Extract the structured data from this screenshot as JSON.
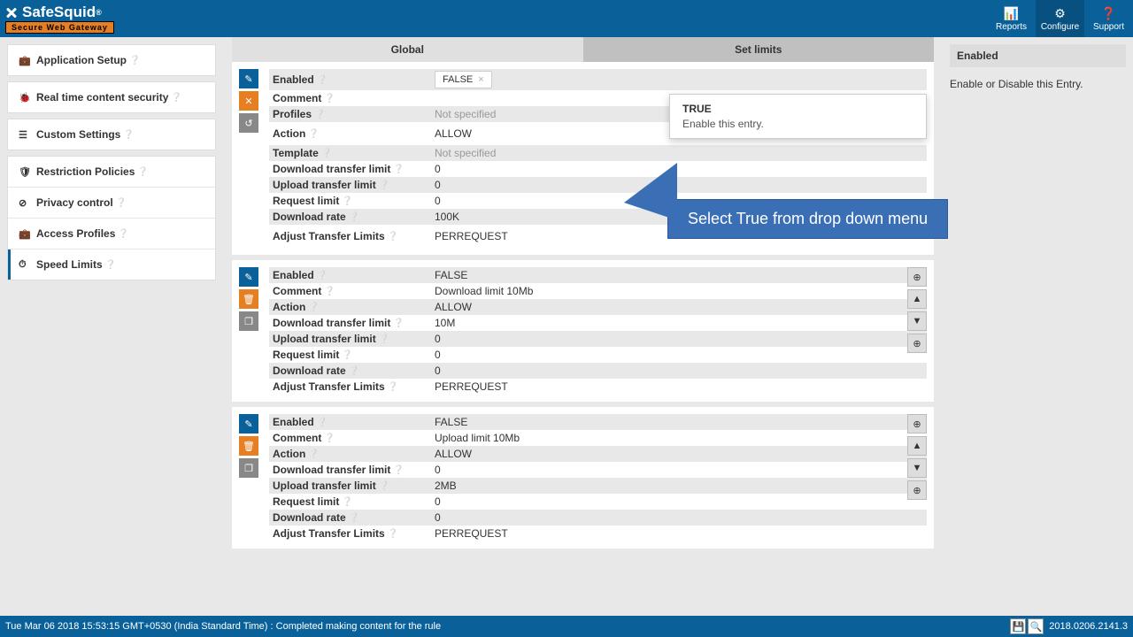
{
  "header": {
    "logo_text": "SafeSquid",
    "logo_reg": "®",
    "tagline": "Secure Web Gateway",
    "nav": [
      {
        "label": "Reports",
        "icon": "📊"
      },
      {
        "label": "Configure",
        "icon": "⚙"
      },
      {
        "label": "Support",
        "icon": "❓"
      }
    ]
  },
  "sidebar": {
    "groups": [
      {
        "items": [
          {
            "icon": "💼",
            "label": "Application Setup",
            "help": true
          }
        ]
      },
      {
        "items": [
          {
            "icon": "🐞",
            "label": "Real time content security",
            "help": true
          }
        ]
      },
      {
        "items": [
          {
            "icon": "☰",
            "label": "Custom Settings",
            "help": true
          }
        ]
      },
      {
        "items": [
          {
            "icon": "🛡",
            "label": "Restriction Policies",
            "help": true
          },
          {
            "icon": "⊘",
            "label": "Privacy control",
            "help": true
          },
          {
            "icon": "💼",
            "label": "Access Profiles",
            "help": true
          },
          {
            "icon": "⏱",
            "label": "Speed Limits",
            "help": true,
            "active": true
          }
        ]
      }
    ]
  },
  "tabs": [
    {
      "label": "Global"
    },
    {
      "label": "Set limits",
      "active": true
    }
  ],
  "panels": [
    {
      "type": "edit",
      "actions": [
        "edit",
        "del",
        "rev"
      ],
      "fields": [
        {
          "label": "Enabled",
          "value_tag": "FALSE"
        },
        {
          "label": "Comment",
          "tall": true,
          "value": ""
        },
        {
          "label": "Profiles",
          "not_spec": "Not specified"
        },
        {
          "label": "Action",
          "tall": true,
          "value": "ALLOW"
        },
        {
          "label": "Template",
          "not_spec": "Not specified"
        },
        {
          "label": "Download transfer limit",
          "value": "0"
        },
        {
          "label": "Upload transfer limit",
          "value": "0"
        },
        {
          "label": "Request limit",
          "value": "0"
        },
        {
          "label": "Download rate",
          "value": "100K"
        },
        {
          "label": "Adjust Transfer Limits",
          "tall": true,
          "value": "PERREQUEST"
        }
      ],
      "dropdown": {
        "title": "TRUE",
        "desc": "Enable this entry."
      }
    },
    {
      "type": "view",
      "actions": [
        "edit",
        "del",
        "copy"
      ],
      "side_actions": [
        "⊕",
        "▲",
        "▼",
        "⊕"
      ],
      "fields": [
        {
          "label": "Enabled",
          "value": "FALSE"
        },
        {
          "label": "Comment",
          "value": "Download limit 10Mb"
        },
        {
          "label": "Action",
          "value": "ALLOW"
        },
        {
          "label": "Download transfer limit",
          "value": "10M"
        },
        {
          "label": "Upload transfer limit",
          "value": "0"
        },
        {
          "label": "Request limit",
          "value": "0"
        },
        {
          "label": "Download rate",
          "value": "0"
        },
        {
          "label": "Adjust Transfer Limits",
          "value": "PERREQUEST"
        }
      ]
    },
    {
      "type": "view",
      "actions": [
        "edit",
        "del",
        "copy"
      ],
      "side_actions": [
        "⊕",
        "▲",
        "▼",
        "⊕"
      ],
      "fields": [
        {
          "label": "Enabled",
          "value": "FALSE"
        },
        {
          "label": "Comment",
          "value": "Upload limit 10Mb"
        },
        {
          "label": "Action",
          "value": "ALLOW"
        },
        {
          "label": "Download transfer limit",
          "value": "0"
        },
        {
          "label": "Upload transfer limit",
          "value": "2MB"
        },
        {
          "label": "Request limit",
          "value": "0"
        },
        {
          "label": "Download rate",
          "value": "0"
        },
        {
          "label": "Adjust Transfer Limits",
          "value": "PERREQUEST"
        }
      ]
    }
  ],
  "info": {
    "title": "Enabled",
    "desc": "Enable or Disable this Entry."
  },
  "callout": {
    "text": "Select True from drop down menu"
  },
  "footer": {
    "status": "Tue Mar 06 2018 15:53:15 GMT+0530 (India Standard Time) : Completed making content for the rule",
    "version": "2018.0206.2141.3"
  }
}
